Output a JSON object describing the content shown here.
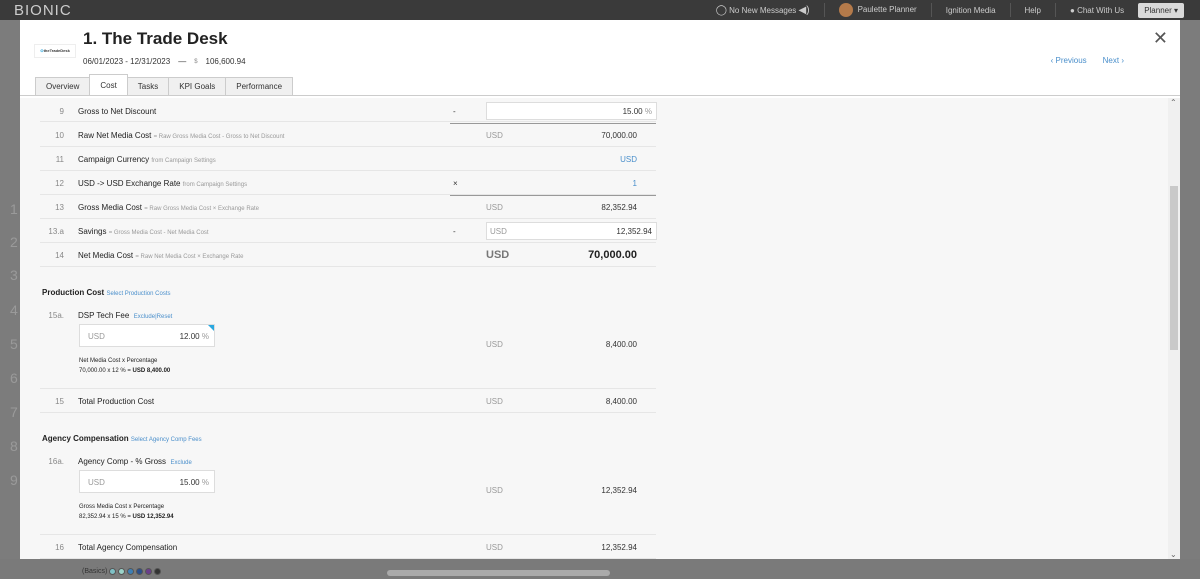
{
  "app": {
    "logo": "BIONIC",
    "messages": "No New Messages",
    "user": "Paulette Planner",
    "org": "Ignition Media",
    "help": "Help",
    "chat": "Chat With Us",
    "planner": "Planner ▾",
    "bg_rows": [
      "1",
      "2",
      "3",
      "4",
      "5",
      "6",
      "7",
      "8",
      "9"
    ],
    "basics": "(Basics)",
    "basics_colors": [
      "#7fc1c6",
      "#9bd3c9",
      "#3d7fb5",
      "#2a4f8c",
      "#6a3e8a",
      "#333333"
    ]
  },
  "modal": {
    "brand_logo": "theTradeDesk",
    "title": "1. The Trade Desk",
    "date_range": "06/01/2023 - 12/31/2023",
    "dash": "—",
    "currency_symbol": "$",
    "budget": "106,600.94",
    "previous": "‹ Previous",
    "next": "Next ›",
    "close": "✕",
    "tabs": [
      "Overview",
      "Cost",
      "Tasks",
      "KPI Goals",
      "Performance"
    ],
    "active_tab": "Cost"
  },
  "rows": {
    "r9": {
      "num": "9",
      "label": "Gross to Net Discount",
      "op": "-",
      "value": "15.00",
      "pct": "%"
    },
    "r10": {
      "num": "10",
      "label": "Raw Net Media Cost",
      "hint": "= Raw Gross Media Cost - Gross to Net Discount",
      "usd": "USD",
      "value": "70,000.00"
    },
    "r11": {
      "num": "11",
      "label": "Campaign Currency",
      "hint": "from Campaign Settings",
      "value": "USD"
    },
    "r12": {
      "num": "12",
      "label": "USD -> USD Exchange Rate",
      "hint": "from Campaign Settings",
      "op": "×",
      "value": "1"
    },
    "r13": {
      "num": "13",
      "label": "Gross Media Cost",
      "hint": "= Raw Gross Media Cost × Exchange Rate",
      "usd": "USD",
      "value": "82,352.94"
    },
    "r13a": {
      "num": "13.a",
      "label": "Savings",
      "hint": "= Gross Media Cost - Net Media Cost",
      "op": "-",
      "usd": "USD",
      "value": "12,352.94"
    },
    "r14": {
      "num": "14",
      "label": "Net Media Cost",
      "hint": "= Raw Net Media Cost × Exchange Rate",
      "usd": "USD",
      "value": "70,000.00"
    }
  },
  "production": {
    "title": "Production Cost",
    "link": "Select Production Costs",
    "r15a": {
      "num": "15a.",
      "label": "DSP Tech Fee",
      "exclude": "Exclude",
      "sep": "|",
      "reset": "Reset",
      "box_usd": "USD",
      "box_value": "12.00",
      "pct": "%",
      "formula": "Net Media Cost x Percentage",
      "calc": "70,000.00 x 12 % =",
      "calc_result": "USD 8,400.00",
      "usd": "USD",
      "value": "8,400.00"
    },
    "r15": {
      "num": "15",
      "label": "Total Production Cost",
      "usd": "USD",
      "value": "8,400.00"
    }
  },
  "agency": {
    "title": "Agency Compensation",
    "link": "Select Agency Comp Fees",
    "r16a": {
      "num": "16a.",
      "label": "Agency Comp - % Gross",
      "exclude": "Exclude",
      "box_usd": "USD",
      "box_value": "15.00",
      "pct": "%",
      "formula": "Gross Media Cost x Percentage",
      "calc": "82,352.94 x 15 % =",
      "calc_result": "USD 12,352.94",
      "usd": "USD",
      "value": "12,352.94"
    },
    "r16": {
      "num": "16",
      "label": "Total Agency Compensation",
      "usd": "USD",
      "value": "12,352.94"
    }
  }
}
